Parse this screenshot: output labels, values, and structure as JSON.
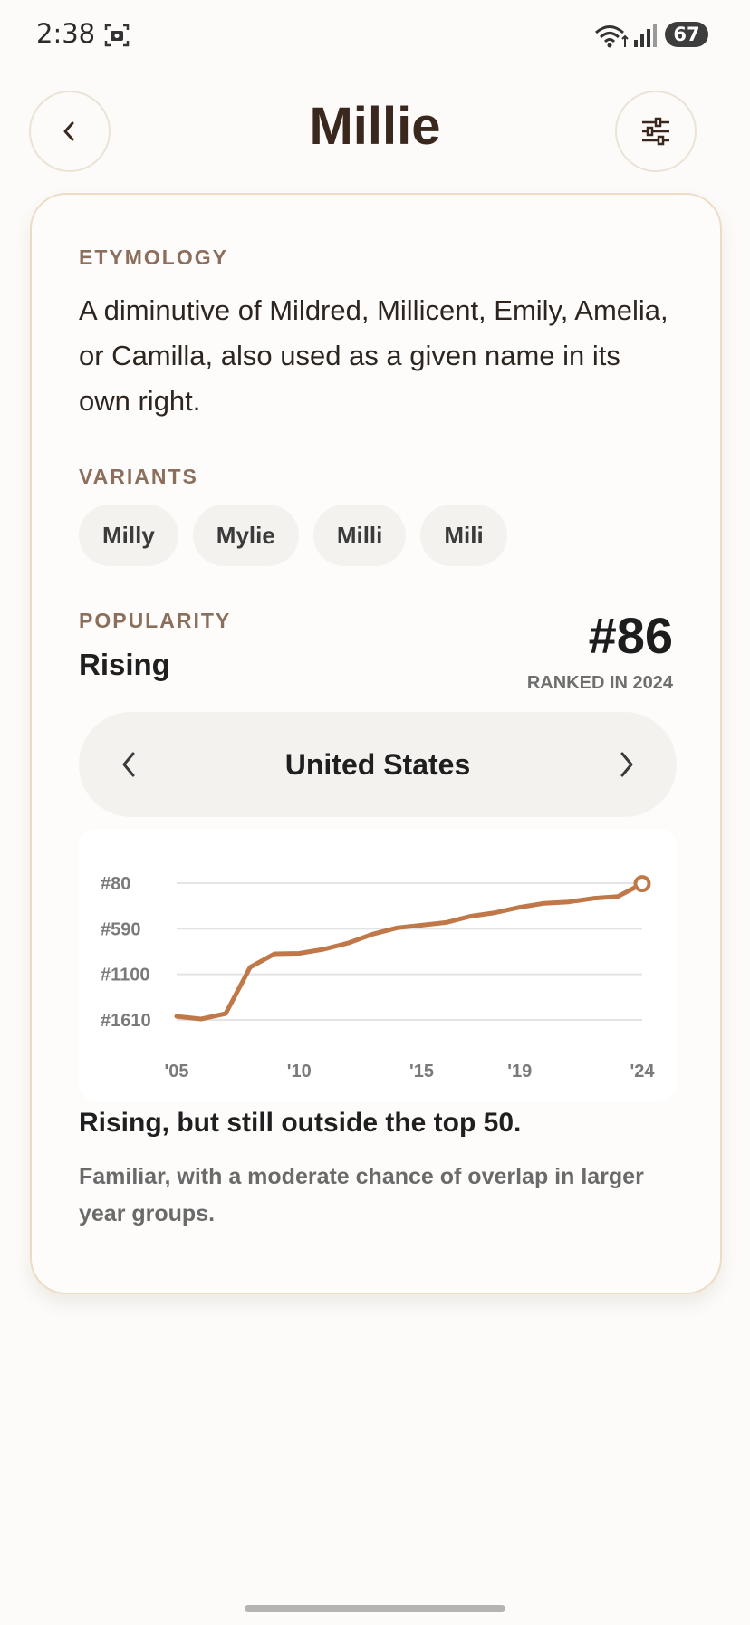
{
  "status_bar": {
    "time": "2:38",
    "battery": "67"
  },
  "header": {
    "title": "Millie"
  },
  "etymology": {
    "label": "ETYMOLOGY",
    "text": "A diminutive of Mildred, Millicent, Emily, Amelia, or Camilla, also used as a given name in its own right."
  },
  "variants": {
    "label": "VARIANTS",
    "items": [
      "Milly",
      "Mylie",
      "Milli",
      "Mili"
    ]
  },
  "popularity": {
    "label": "POPULARITY",
    "status": "Rising",
    "rank": "#86",
    "rank_caption": "RANKED IN 2024",
    "country": "United States"
  },
  "colors": {
    "accent": "#c07848",
    "grid": "#e4e4e4"
  },
  "chart_data": {
    "type": "line",
    "y_tick_labels": [
      "#80",
      "#590",
      "#1100",
      "#1610"
    ],
    "y_ticks": [
      80,
      590,
      1100,
      1610
    ],
    "x_tick_labels": [
      "'05",
      "'10",
      "'15",
      "'19",
      "'24"
    ],
    "x_ticks": [
      2005,
      2010,
      2015,
      2019,
      2024
    ],
    "xlim": [
      2005,
      2024
    ],
    "ylim": [
      1610,
      80
    ],
    "y_inverted": true,
    "grid": true,
    "x": [
      2005,
      2006,
      2007,
      2008,
      2009,
      2010,
      2011,
      2012,
      2013,
      2014,
      2015,
      2016,
      2017,
      2018,
      2019,
      2020,
      2021,
      2022,
      2023,
      2024
    ],
    "y": [
      1570,
      1600,
      1540,
      1020,
      870,
      865,
      820,
      750,
      650,
      580,
      550,
      520,
      450,
      410,
      350,
      305,
      290,
      250,
      230,
      86
    ]
  },
  "summary": {
    "title": "Rising, but still outside the top 50.",
    "text": "Familiar, with a moderate chance of overlap in larger year groups."
  }
}
